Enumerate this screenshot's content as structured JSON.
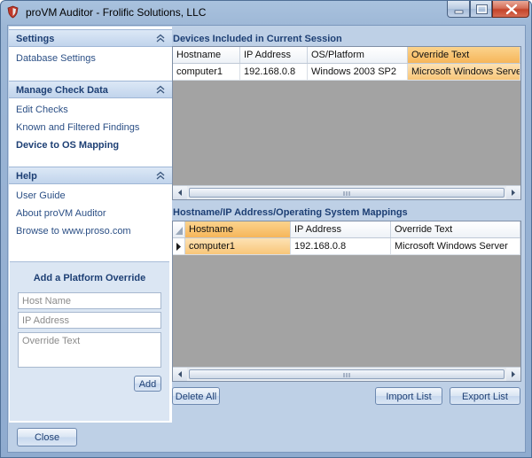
{
  "window": {
    "title": "proVM Auditor - Frolific Solutions, LLC"
  },
  "sidebar": {
    "settings": {
      "header": "Settings",
      "items": [
        "Database Settings"
      ]
    },
    "manage": {
      "header": "Manage Check Data",
      "items": [
        "Edit Checks",
        "Known and Filtered Findings",
        "Device to OS Mapping"
      ]
    },
    "help": {
      "header": "Help",
      "items": [
        "User Guide",
        "About proVM Auditor",
        "Browse to www.proso.com"
      ]
    }
  },
  "override": {
    "title": "Add a Platform Override",
    "hostname_placeholder": "Host Name",
    "ip_placeholder": "IP Address",
    "text_placeholder": "Override Text",
    "add_label": "Add"
  },
  "devices": {
    "title": "Devices Included in Current Session",
    "columns": [
      "Hostname",
      "IP Address",
      "OS/Platform",
      "Override Text"
    ],
    "rows": [
      [
        "computer1",
        "192.168.0.8",
        "Windows 2003 SP2",
        "Microsoft Windows Server"
      ]
    ]
  },
  "mappings": {
    "title": "Hostname/IP Address/Operating System Mappings",
    "columns": [
      "Hostname",
      "IP Address",
      "Override Text"
    ],
    "rows": [
      [
        "computer1",
        "192.168.0.8",
        "Microsoft Windows Server"
      ]
    ]
  },
  "buttons": {
    "delete_all": "Delete All",
    "import": "Import List",
    "export": "Export List",
    "close": "Close"
  }
}
